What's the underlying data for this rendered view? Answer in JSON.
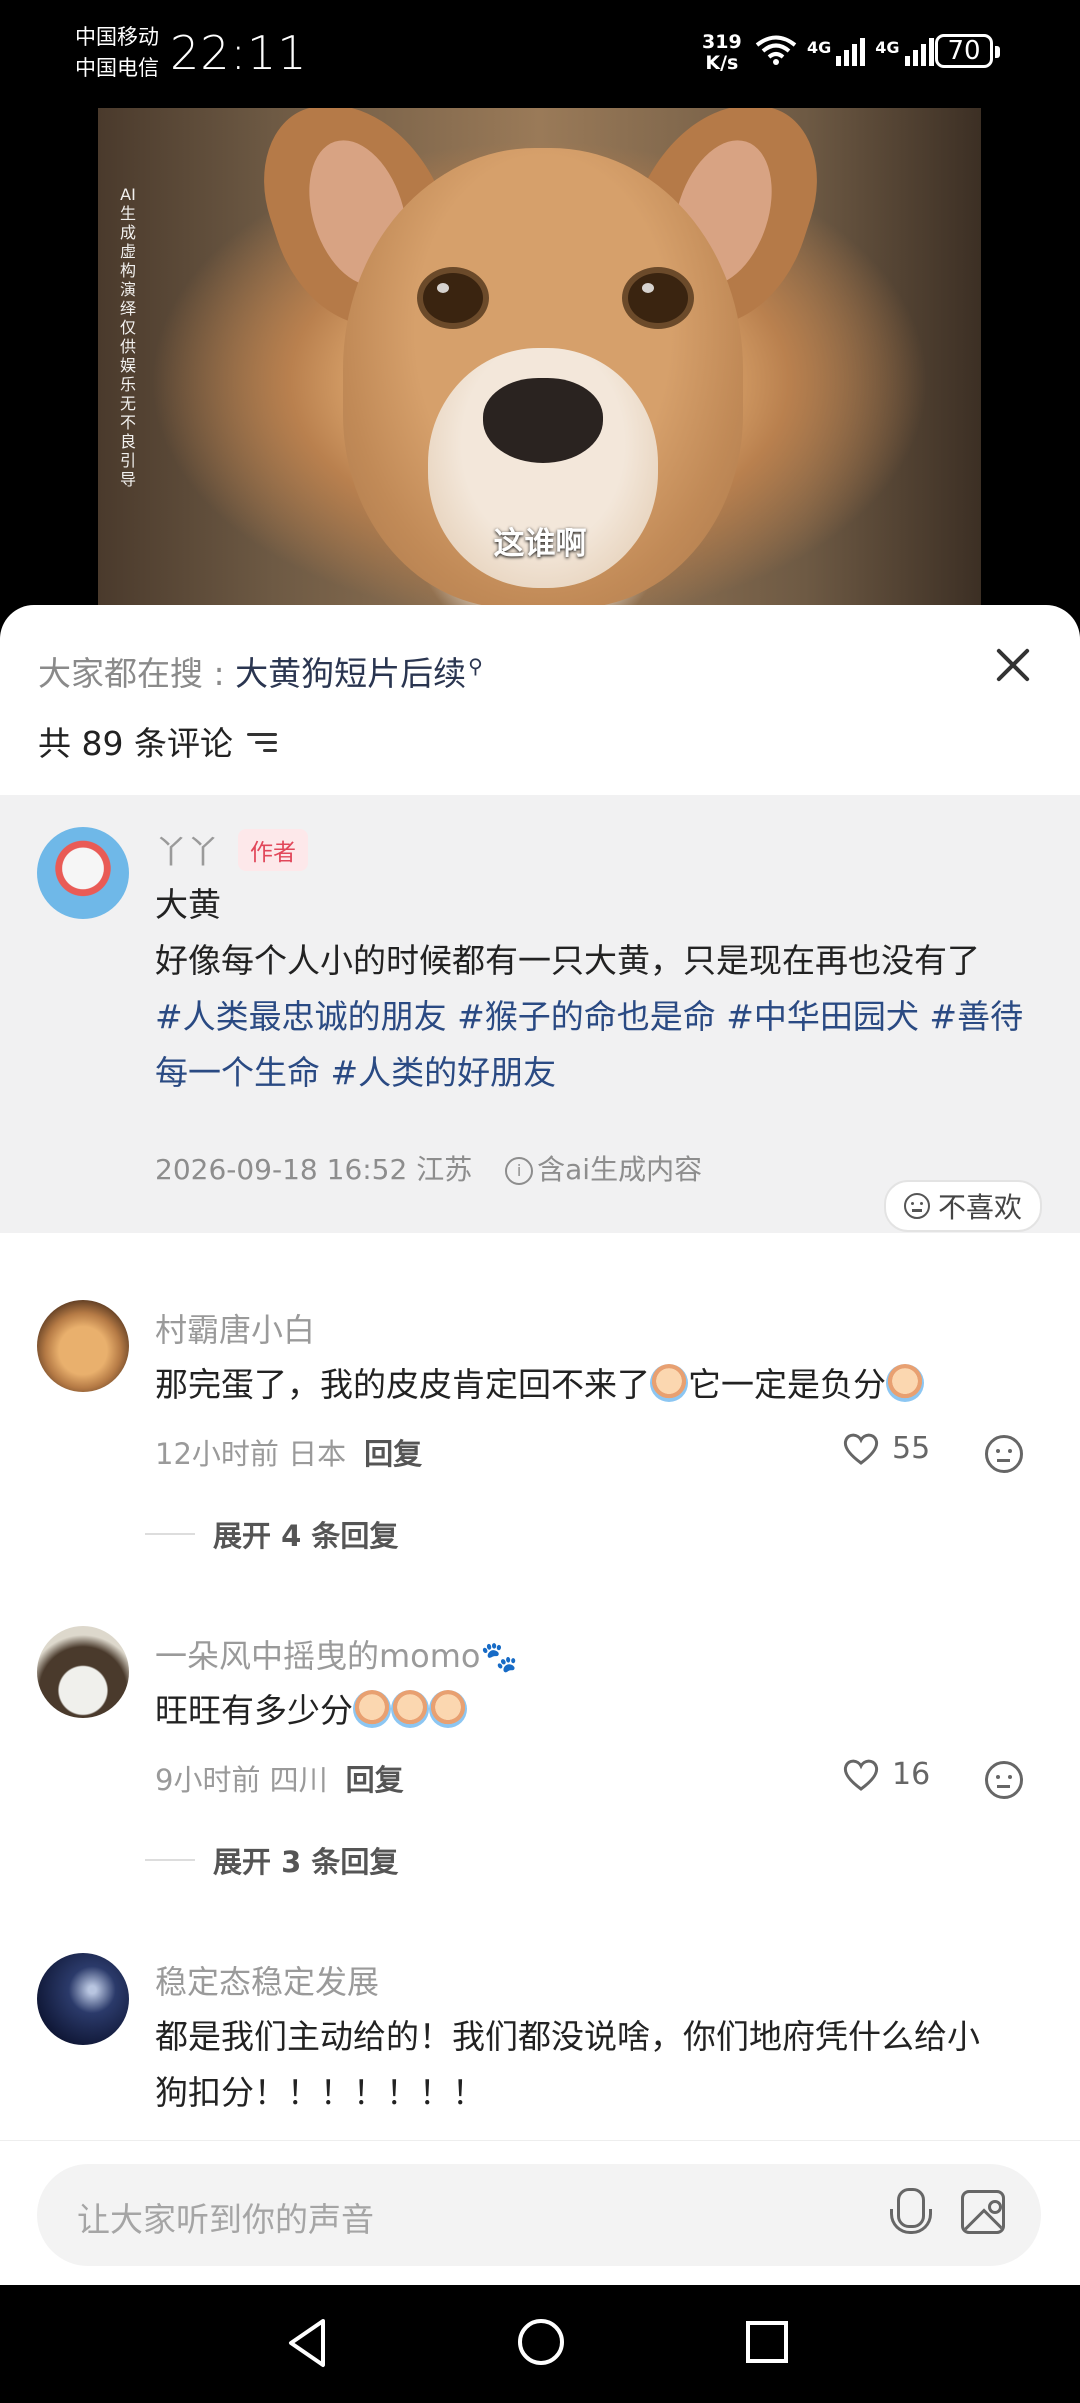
{
  "status": {
    "carrier1": "中国移动",
    "carrier2": "中国电信",
    "time": "22:11",
    "speed_value": "319",
    "speed_unit": "K/s",
    "net1": "4G",
    "net2": "4G",
    "battery": "70"
  },
  "video": {
    "ai_note": "AI生成 虚构演绎 仅供娱乐 无不良引导",
    "subtitle": "这谁啊"
  },
  "search": {
    "prefix": "大家都在搜 : ",
    "keyword": "大黄狗短片后续"
  },
  "comments_header": {
    "count_label": "共 89 条评论"
  },
  "pinned": {
    "username": "丫丫",
    "badge": "作者",
    "title": "大黄",
    "text": "好像每个人小的时候都有一只大黄，只是现在再也没有了",
    "tags_line1": "#人类最忠诚的朋友 #猴子的命也是命 #中华田园犬 #善待",
    "tags_line2": "每一个生命 #人类的好朋友",
    "meta": "2026-09-18 16:52  江苏",
    "ai_label": "含ai生成内容",
    "dislike": "不喜欢"
  },
  "comments": [
    {
      "username": "村霸唐小白",
      "text_a": "那完蛋了，我的皮皮肯定回不来了",
      "text_b": "它一定是负分",
      "meta": "12小时前 日本",
      "reply": "回复",
      "likes": "55",
      "expand": "展开 4 条回复"
    },
    {
      "username": "一朵风中摇曳的momo",
      "username_suffix": "🐾",
      "text": "旺旺有多少分",
      "meta": "9小时前 四川",
      "reply": "回复",
      "likes": "16",
      "expand": "展开 3 条回复"
    },
    {
      "username": "稳定态稳定发展",
      "text_line1": "都是我们主动给的！我们都没说啥，你们地府凭什么给小",
      "text_line2": "狗扣分！！！！！！！"
    }
  ],
  "input": {
    "placeholder": "让大家听到你的声音"
  },
  "icons": [
    "close-icon",
    "filter-icon",
    "info-icon",
    "smile-icon",
    "heart-icon",
    "emoji-icon",
    "mic-icon",
    "image-icon",
    "back-icon",
    "home-icon",
    "recent-icon"
  ]
}
